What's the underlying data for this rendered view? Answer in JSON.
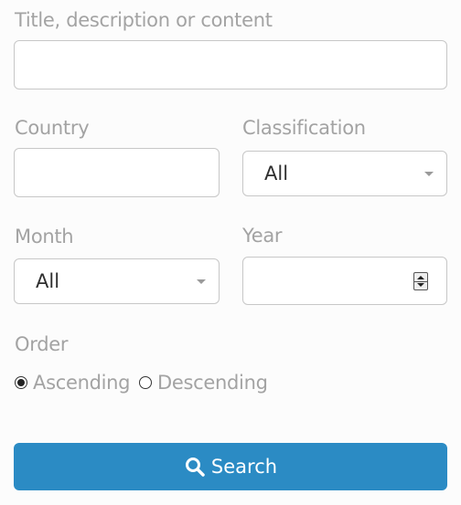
{
  "search": {
    "text_label": "Title, description or content",
    "text_value": "",
    "country_label": "Country",
    "country_value": "",
    "classification_label": "Classification",
    "classification_value": "All",
    "month_label": "Month",
    "month_value": "All",
    "year_label": "Year",
    "year_value": "",
    "order_label": "Order",
    "order_options": [
      {
        "label": "Ascending",
        "checked": true
      },
      {
        "label": "Descending",
        "checked": false
      }
    ],
    "button_label": "Search",
    "button_icon": "search-icon"
  },
  "colors": {
    "button_bg": "#2b8bc4",
    "label": "#a3a3a3"
  }
}
